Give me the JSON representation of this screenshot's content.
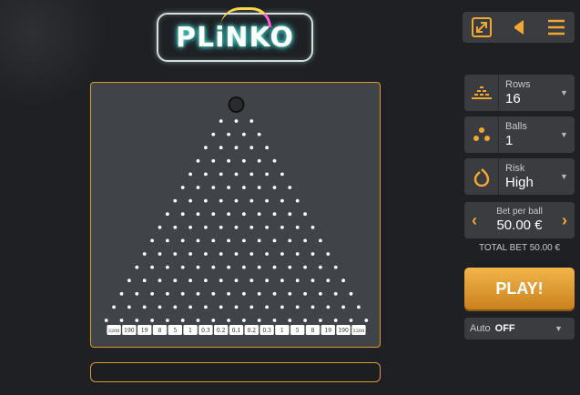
{
  "logo": {
    "text": "PLiNKO"
  },
  "toolbar": {
    "fullscreen_icon": "expand-icon",
    "sound_icon": "speaker-icon",
    "menu_icon": "hamburger-icon"
  },
  "controls": {
    "rows": {
      "label": "Rows",
      "value": "16",
      "icon": "pyramid-icon"
    },
    "balls": {
      "label": "Balls",
      "value": "1",
      "icon": "balls-icon"
    },
    "risk": {
      "label": "Risk",
      "value": "High",
      "icon": "flame-icon"
    }
  },
  "bet": {
    "label": "Bet per ball",
    "value": "50.00 €",
    "decrease": "‹",
    "increase": "›"
  },
  "total_bet": "TOTAL BET 50.00 €",
  "play_label": "PLAY!",
  "auto": {
    "label": "Auto",
    "value": "OFF"
  },
  "board": {
    "rows": 16,
    "multipliers": [
      "3200",
      "190",
      "19",
      "8",
      "5",
      "1",
      "0.3",
      "0.2",
      "0.1",
      "0.2",
      "0.3",
      "1",
      "5",
      "8",
      "19",
      "190",
      "3200"
    ]
  },
  "colors": {
    "accent": "#d99b2b",
    "play": "#e3a03a",
    "board": "#404347"
  }
}
